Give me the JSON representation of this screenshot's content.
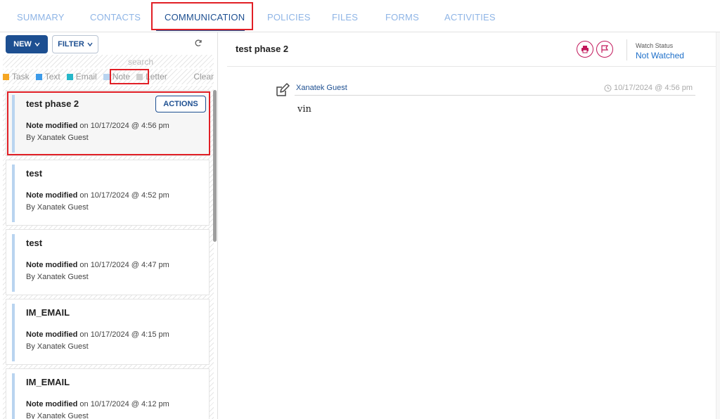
{
  "tabs": [
    {
      "label": "SUMMARY"
    },
    {
      "label": "CONTACTS"
    },
    {
      "label": "COMMUNICATION",
      "active": true
    },
    {
      "label": "POLICIES"
    },
    {
      "label": "FILES"
    },
    {
      "label": "FORMS"
    },
    {
      "label": "ACTIVITIES"
    }
  ],
  "toolbar": {
    "new_label": "NEW",
    "filter_label": "FILTER",
    "search_placeholder": "search"
  },
  "legend": {
    "items": [
      {
        "label": "Task",
        "color": "#f5a623"
      },
      {
        "label": "Text",
        "color": "#3d9be9"
      },
      {
        "label": "Email",
        "color": "#26b7c9"
      },
      {
        "label": "Note",
        "color": "#b9d4f0"
      },
      {
        "label": "Letter",
        "color": "#cfcfcf"
      }
    ],
    "clear_label": "Clear"
  },
  "list": {
    "actions_label": "ACTIONS",
    "items": [
      {
        "title": "test phase 2",
        "type_label": "Note modified",
        "date_text": " on 10/17/2024 @ 4:56 pm",
        "by_text": "By Xanatek Guest"
      },
      {
        "title": "test",
        "type_label": "Note modified",
        "date_text": " on 10/17/2024 @ 4:52 pm",
        "by_text": "By Xanatek Guest"
      },
      {
        "title": "test",
        "type_label": "Note modified",
        "date_text": " on 10/17/2024 @ 4:47 pm",
        "by_text": "By Xanatek Guest"
      },
      {
        "title": "IM_EMAIL",
        "type_label": "Note modified",
        "date_text": " on 10/17/2024 @ 4:15 pm",
        "by_text": "By Xanatek Guest"
      },
      {
        "title": "IM_EMAIL",
        "type_label": "Note modified",
        "date_text": " on 10/17/2024 @ 4:12 pm",
        "by_text": "By Xanatek Guest"
      }
    ]
  },
  "detail": {
    "title": "test phase 2",
    "watch_label": "Watch Status",
    "watch_value": "Not Watched",
    "author": "Xanatek Guest",
    "timestamp": "10/17/2024 @ 4:56 pm",
    "body": "vin"
  }
}
